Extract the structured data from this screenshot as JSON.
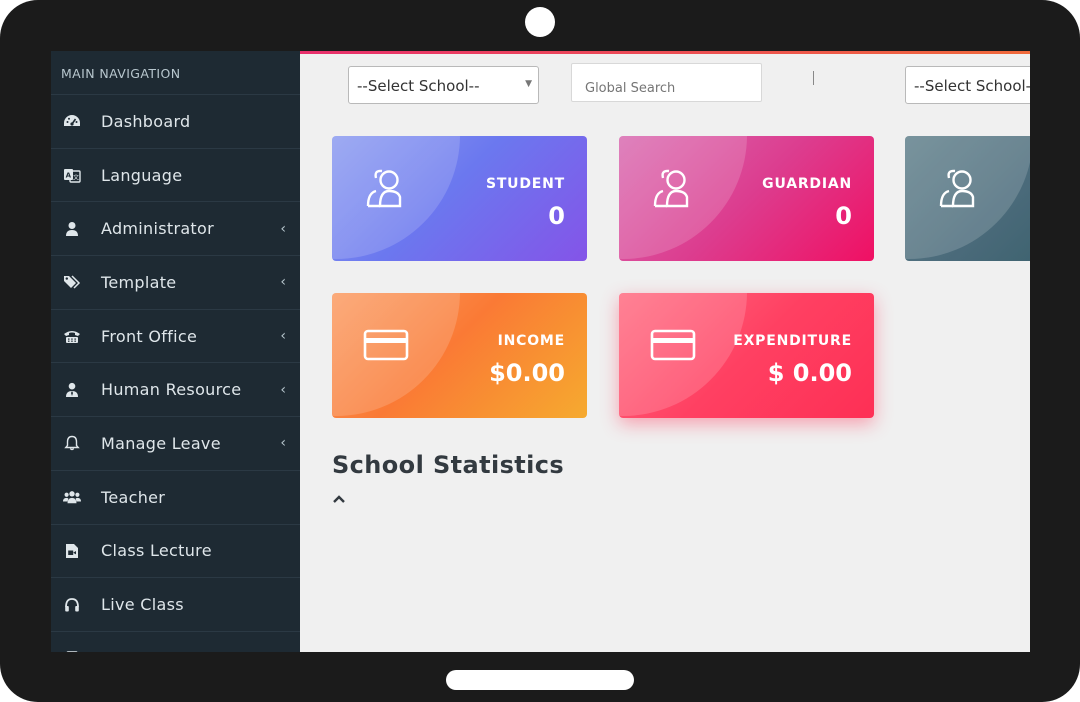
{
  "sidebar": {
    "header": "MAIN NAVIGATION",
    "items": [
      {
        "label": "Dashboard",
        "icon": "dashboard-icon",
        "has_submenu": false
      },
      {
        "label": "Language",
        "icon": "language-icon",
        "has_submenu": false
      },
      {
        "label": "Administrator",
        "icon": "user-icon",
        "has_submenu": true
      },
      {
        "label": "Template",
        "icon": "tags-icon",
        "has_submenu": true
      },
      {
        "label": "Front Office",
        "icon": "phone-icon",
        "has_submenu": true
      },
      {
        "label": "Human Resource",
        "icon": "user-tie-icon",
        "has_submenu": true
      },
      {
        "label": "Manage Leave",
        "icon": "bell-icon",
        "has_submenu": true
      },
      {
        "label": "Teacher",
        "icon": "users-icon",
        "has_submenu": false
      },
      {
        "label": "Class Lecture",
        "icon": "file-video-icon",
        "has_submenu": false
      },
      {
        "label": "Live Class",
        "icon": "headphones-icon",
        "has_submenu": false
      }
    ],
    "chevron": "‹"
  },
  "toolbar": {
    "school_select_1": "--Select School--",
    "search_placeholder": "Global Search",
    "school_select_2": "--Select School--"
  },
  "cards": {
    "student": {
      "label": "STUDENT",
      "value": "0",
      "icon": "users-outline-icon"
    },
    "guardian": {
      "label": "GUARDIAN",
      "value": "0",
      "icon": "users-outline-icon"
    },
    "teacher": {
      "icon": "users-outline-icon"
    },
    "income": {
      "label": "INCOME",
      "value": "$0.00",
      "icon": "credit-card-icon"
    },
    "expenditure": {
      "label": "EXPENDITURE",
      "value": "$ 0.00",
      "icon": "credit-card-icon"
    }
  },
  "stats": {
    "title": "School Statistics",
    "collapse_icon": "chevron-up-icon"
  },
  "colors": {
    "sidebar_bg": "#1e2a33",
    "accent_start": "#e8306d",
    "accent_end": "#f06a3b"
  }
}
